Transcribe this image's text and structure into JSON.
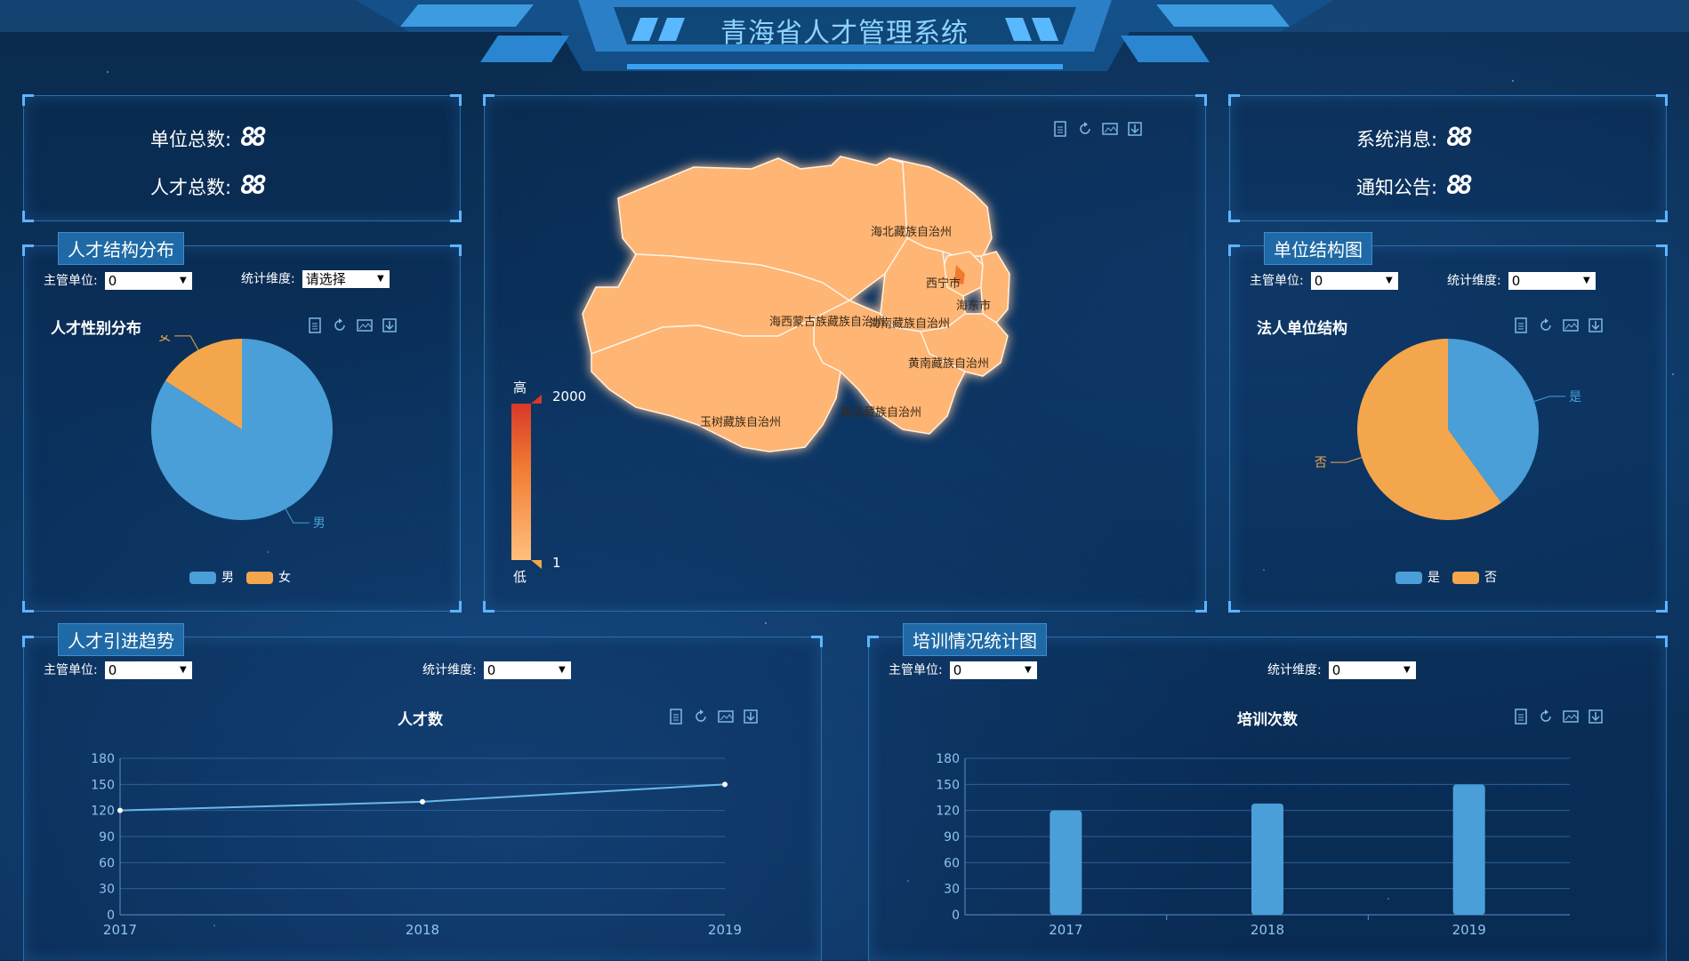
{
  "app": {
    "title": "青海省人才管理系统"
  },
  "stats_left": [
    {
      "label": "单位总数:",
      "value": "88"
    },
    {
      "label": "人才总数:",
      "value": "88"
    }
  ],
  "stats_right": [
    {
      "label": "系统消息:",
      "value": "88"
    },
    {
      "label": "通知公告:",
      "value": "88"
    }
  ],
  "panels": {
    "talent_structure": {
      "tab": "人才结构分布",
      "filter1_label": "主管单位:",
      "filter1_value": "0",
      "filter2_label": "统计维度:",
      "filter2_value": "请选择",
      "chart_title": "人才性别分布"
    },
    "unit_structure": {
      "tab": "单位结构图",
      "filter1_label": "主管单位:",
      "filter1_value": "0",
      "filter2_label": "统计维度:",
      "filter2_value": "0",
      "chart_title": "法人单位结构"
    },
    "talent_trend": {
      "tab": "人才引进趋势",
      "filter1_label": "主管单位:",
      "filter1_value": "0",
      "filter2_label": "统计维度:",
      "filter2_value": "0",
      "chart_title": "人才数"
    },
    "training": {
      "tab": "培训情况统计图",
      "filter1_label": "主管单位:",
      "filter1_value": "0",
      "filter2_label": "统计维度:",
      "filter2_value": "0",
      "chart_title": "培训次数"
    }
  },
  "map": {
    "visual_map": {
      "high_label": "高",
      "low_label": "低",
      "max": "2000",
      "min": "1"
    },
    "regions": [
      "海北藏族自治州",
      "西宁市",
      "海东市",
      "海西蒙古族藏族自治州",
      "海南藏族自治州",
      "黄南藏族自治州",
      "玉树藏族自治州",
      "果洛藏族自治州"
    ]
  },
  "colors": {
    "blue": "#4a9fd8",
    "orange": "#f4a64c",
    "map_fill": "#ffb573"
  },
  "chart_data": [
    {
      "type": "pie",
      "title": "人才性别分布",
      "series": [
        {
          "name": "男",
          "value": 84
        },
        {
          "name": "女",
          "value": 16
        }
      ],
      "legend": [
        "男",
        "女"
      ]
    },
    {
      "type": "pie",
      "title": "法人单位结构",
      "series": [
        {
          "name": "是",
          "value": 40
        },
        {
          "name": "否",
          "value": 60
        }
      ],
      "legend": [
        "是",
        "否"
      ]
    },
    {
      "type": "line",
      "title": "人才数",
      "categories": [
        "2017",
        "2018",
        "2019"
      ],
      "values": [
        120,
        130,
        150
      ],
      "ylim": [
        0,
        180
      ],
      "yticks": [
        0,
        30,
        60,
        90,
        120,
        150,
        180
      ]
    },
    {
      "type": "bar",
      "title": "培训次数",
      "categories": [
        "2017",
        "2018",
        "2019"
      ],
      "values": [
        120,
        128,
        150
      ],
      "ylim": [
        0,
        180
      ],
      "yticks": [
        0,
        30,
        60,
        90,
        120,
        150,
        180
      ]
    }
  ]
}
